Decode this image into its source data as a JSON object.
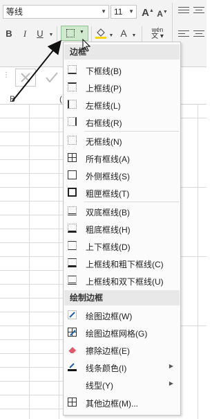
{
  "ribbon": {
    "font_name": "等线",
    "font_size": "11",
    "bold": "B",
    "italic": "I",
    "underline": "U",
    "font_color_glyph": "A",
    "grow_font": "A",
    "shrink_font": "A",
    "phonetic": "wén"
  },
  "sheet": {
    "col_label": "B"
  },
  "menu": {
    "section_borders": "边框",
    "section_draw": "绘制边框",
    "items": [
      {
        "label": "下框线(B)",
        "icon": "bottom-border-icon"
      },
      {
        "label": "上框线(P)",
        "icon": "top-border-icon"
      },
      {
        "label": "左框线(L)",
        "icon": "left-border-icon"
      },
      {
        "label": "右框线(R)",
        "icon": "right-border-icon"
      },
      {
        "label": "无框线(N)",
        "icon": "no-border-icon"
      },
      {
        "label": "所有框线(A)",
        "icon": "all-borders-icon"
      },
      {
        "label": "外侧框线(S)",
        "icon": "outside-borders-icon"
      },
      {
        "label": "粗匣框线(T)",
        "icon": "thick-box-border-icon"
      },
      {
        "label": "双底框线(B)",
        "icon": "double-bottom-border-icon"
      },
      {
        "label": "粗底框线(H)",
        "icon": "thick-bottom-border-icon"
      },
      {
        "label": "上下框线(D)",
        "icon": "top-bottom-border-icon"
      },
      {
        "label": "上框线和粗下框线(C)",
        "icon": "top-thick-bottom-border-icon"
      },
      {
        "label": "上框线和双下框线(U)",
        "icon": "top-double-bottom-border-icon"
      }
    ],
    "draw_items": [
      {
        "label": "绘图边框(W)",
        "icon": "draw-border-icon"
      },
      {
        "label": "绘图边框网格(G)",
        "icon": "draw-border-grid-icon"
      },
      {
        "label": "擦除边框(E)",
        "icon": "eraser-icon"
      },
      {
        "label": "线条颜色(I)",
        "icon": "line-color-icon"
      },
      {
        "label": "线型(Y)",
        "icon": "line-style-icon"
      },
      {
        "label": "其他边框(M)...",
        "icon": "more-borders-icon"
      }
    ]
  }
}
